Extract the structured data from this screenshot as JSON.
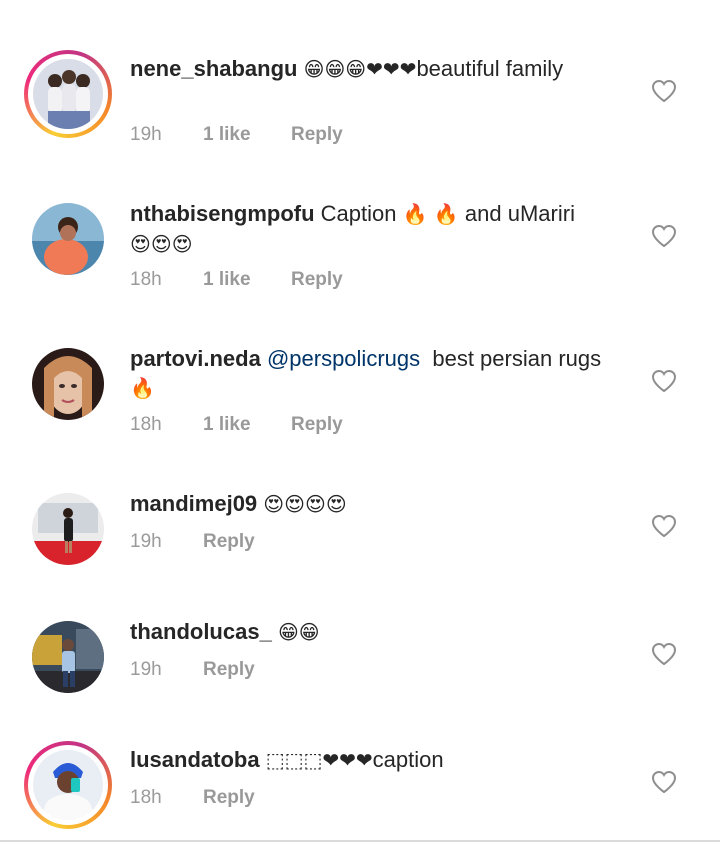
{
  "comments": [
    {
      "username": "nene_shabangu",
      "body_pre": "",
      "emoji": "😁😁😁❤❤❤",
      "body": "beautiful family",
      "time": "19h",
      "likes": "1 like",
      "reply": "Reply",
      "story_ring": true,
      "avatar_icon": "group-photo-avatar"
    },
    {
      "username": "nthabisengmpofu",
      "body_pre": "Caption ",
      "emoji": "🔥 🔥",
      "body": " and uMariri",
      "emoji2": "😍😍😍",
      "time": "18h",
      "likes": "1 like",
      "reply": "Reply",
      "story_ring": false,
      "avatar_icon": "woman-at-sea-avatar"
    },
    {
      "username": "partovi.neda",
      "mention": "@perspolicrugs",
      "body": "  best persian rugs ",
      "emoji": "🔥",
      "time": "18h",
      "likes": "1 like",
      "reply": "Reply",
      "story_ring": false,
      "avatar_icon": "portrait-avatar"
    },
    {
      "username": "mandimej09",
      "emoji": "😍😍😍😍",
      "time": "19h",
      "reply": "Reply",
      "story_ring": false,
      "avatar_icon": "red-carpet-avatar"
    },
    {
      "username": "thandolucas_",
      "emoji": "😁😁",
      "time": "19h",
      "reply": "Reply",
      "story_ring": false,
      "avatar_icon": "street-avatar"
    },
    {
      "username": "lusandatoba",
      "emoji": "⬚⬚⬚❤❤❤",
      "body": "caption",
      "time": "18h",
      "reply": "Reply",
      "story_ring": true,
      "avatar_icon": "selfie-avatar"
    }
  ],
  "colors": {
    "text": "#262626",
    "meta": "#999999",
    "mention": "#003569",
    "heart_outline": "#8e8e8e"
  },
  "icons": {
    "like": "heart-outline-icon"
  }
}
